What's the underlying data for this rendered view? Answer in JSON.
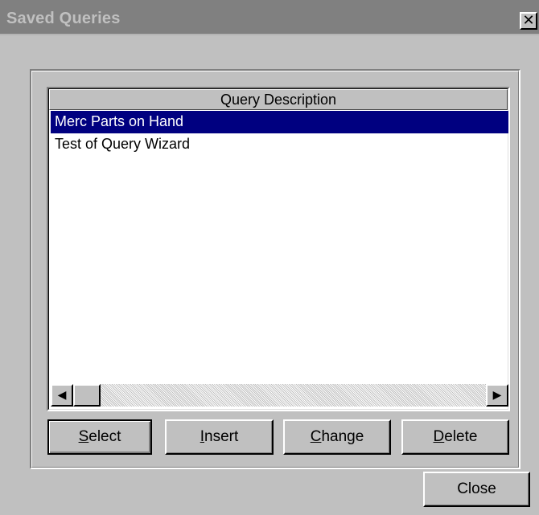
{
  "window": {
    "title": "Saved Queries",
    "close_glyph": "✕"
  },
  "list": {
    "column_header": "Query Description",
    "rows": [
      {
        "label": "Merc Parts on Hand",
        "selected": true
      },
      {
        "label": "Test of Query Wizard",
        "selected": false
      }
    ]
  },
  "scrollbar": {
    "left_icon": "arrow-left-icon",
    "right_icon": "arrow-right-icon"
  },
  "buttons": {
    "select": {
      "accel": "S",
      "rest": "elect"
    },
    "insert": {
      "accel": "I",
      "rest": "nsert"
    },
    "change": {
      "accel": "C",
      "rest": "hange"
    },
    "delete": {
      "accel": "D",
      "rest": "elete"
    },
    "close": "Close"
  },
  "colors": {
    "face": "#c0c0c0",
    "titlebar_inactive": "#808080",
    "selection": "#000080"
  }
}
